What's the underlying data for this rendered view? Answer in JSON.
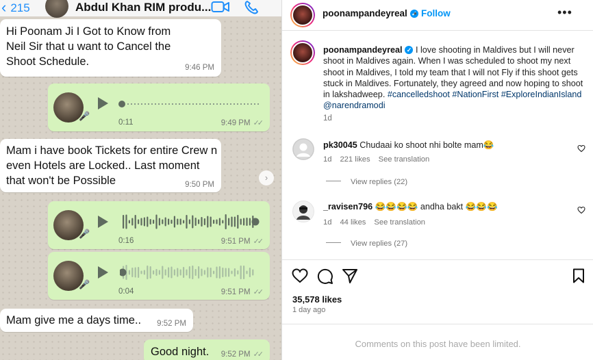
{
  "whatsapp": {
    "back_count": "215",
    "contact_name": "Abdul Khan RIM produ...",
    "messages": [
      {
        "type": "text",
        "dir": "in",
        "text": "Hi Poonam Ji I Got to Know from Neil Sir that u want to Cancel the Shoot Schedule.",
        "time": "9:46 PM"
      },
      {
        "type": "voice",
        "dir": "out",
        "duration": "0:11",
        "time": "9:49 PM"
      },
      {
        "type": "text",
        "dir": "in",
        "text": "Mam i have book Tickets for entire Crew n even Hotels are Locked.. Last moment that won't be Possible",
        "time": "9:50 PM"
      },
      {
        "type": "voice",
        "dir": "out",
        "duration": "0:16",
        "time": "9:51 PM"
      },
      {
        "type": "voice",
        "dir": "out",
        "duration": "0:04",
        "time": "9:51 PM"
      },
      {
        "type": "text",
        "dir": "in",
        "text": "Mam give me a days time..",
        "time": "9:52 PM"
      },
      {
        "type": "text",
        "dir": "out",
        "text": "Good night.",
        "time": "9:52 PM"
      }
    ]
  },
  "instagram": {
    "header": {
      "username": "poonampandeyreal",
      "follow_label": "Follow",
      "more_icon": "more-icon"
    },
    "caption": {
      "username": "poonampandeyreal",
      "text": "I love shooting in Maldives but I will never shoot in Maldives again. When I was scheduled to shoot my next shoot in Maldives, I told my team that I will not Fly if this shoot gets stuck in Maldives. Fortunately, they agreed and now hoping to shoot in lakshadweep.",
      "tags": "#cancelledshoot #NationFirst #ExploreIndianIsland @narendramodi",
      "age": "1d"
    },
    "comments": [
      {
        "username": "pk30045",
        "text": "Chudaai ko shoot nhi bolte mam😂",
        "age": "1d",
        "likes": "221 likes",
        "see_translation": "See translation",
        "view_replies": "View replies (22)"
      },
      {
        "username": "_ravisen796",
        "text": "😂😂😂😂 andha bakt 😂😂😂",
        "age": "1d",
        "likes": "44 likes",
        "see_translation": "See translation",
        "view_replies": "View replies (27)"
      }
    ],
    "likes": "35,578 likes",
    "posted": "1 day ago",
    "comments_limited": "Comments on this post have been limited."
  },
  "colors": {
    "whatsapp_out_bubble": "#d6f3bd",
    "ig_blue": "#0095f6",
    "whatsapp_accent": "#1f8efa"
  }
}
